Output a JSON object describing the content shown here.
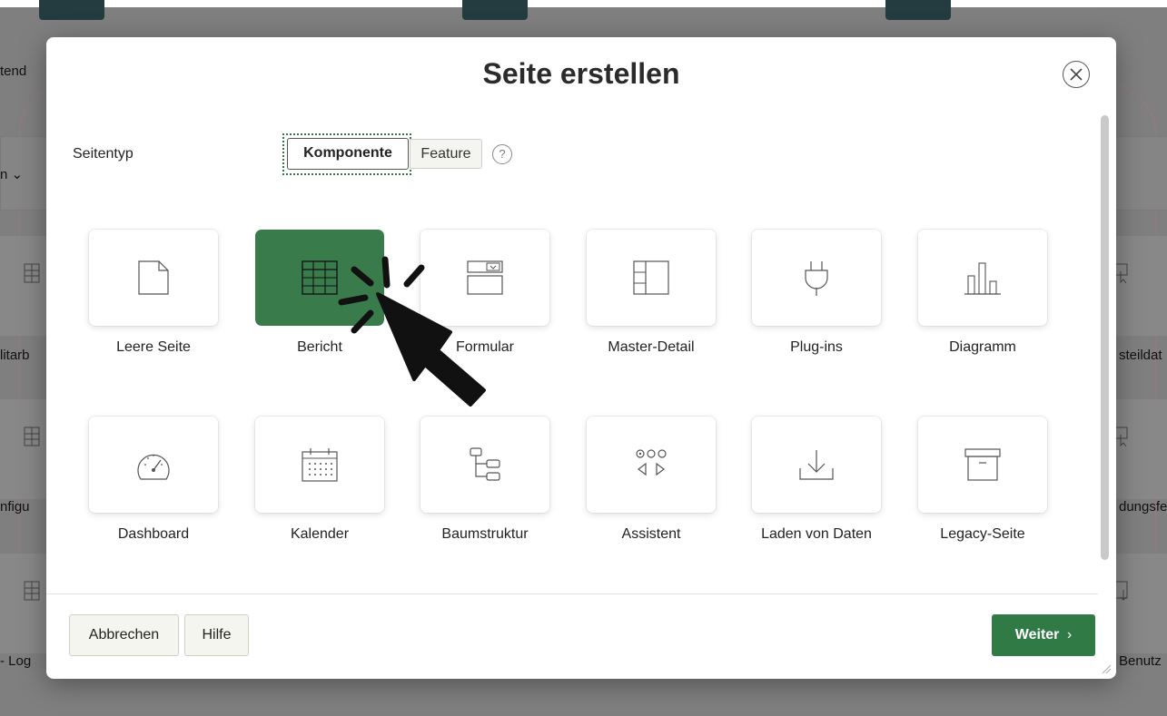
{
  "background": {
    "fragments": [
      "tend",
      "n",
      "litarb",
      "nfigu",
      "- Log",
      "steildat",
      "dungsfe",
      "Benutz"
    ]
  },
  "dialog": {
    "title": "Seite erstellen",
    "page_type_label": "Seitentyp",
    "segments": [
      "Komponente",
      "Feature"
    ],
    "selected_segment": "Komponente",
    "help_glyph": "?",
    "cards_row1": [
      {
        "label": "Leere Seite",
        "icon": "blank-page-icon"
      },
      {
        "label": "Bericht",
        "icon": "report-table-icon",
        "selected": true
      },
      {
        "label": "Formular",
        "icon": "form-icon"
      },
      {
        "label": "Master-Detail",
        "icon": "master-detail-icon"
      },
      {
        "label": "Plug-ins",
        "icon": "plug-icon"
      },
      {
        "label": "Diagramm",
        "icon": "bar-chart-icon"
      }
    ],
    "cards_row2": [
      {
        "label": "Dashboard",
        "icon": "gauge-icon"
      },
      {
        "label": "Kalender",
        "icon": "calendar-icon"
      },
      {
        "label": "Baumstruktur",
        "icon": "tree-icon"
      },
      {
        "label": "Assistent",
        "icon": "wizard-icon"
      },
      {
        "label": "Laden von Daten",
        "icon": "download-icon"
      },
      {
        "label": "Legacy-Seite",
        "icon": "archive-box-icon"
      }
    ],
    "footer": {
      "cancel": "Abbrechen",
      "help": "Hilfe",
      "next": "Weiter",
      "next_chevron": "›"
    }
  },
  "colors": {
    "accent": "#2f7a45",
    "selected_card": "#3a7b4c"
  }
}
